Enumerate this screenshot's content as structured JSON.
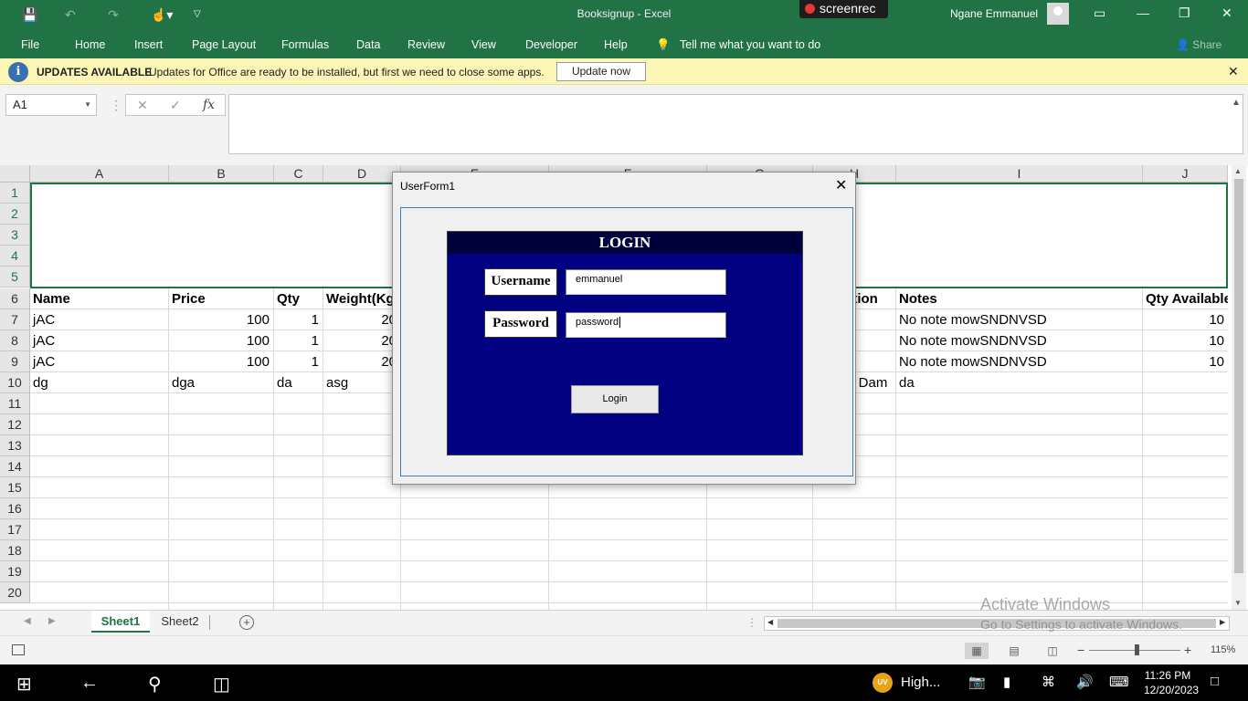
{
  "app": {
    "title": "Booksignup  -  Excel",
    "user_name": "Ngane Emmanuel",
    "screenrec_label": "screenrec",
    "brand_color": "#217346"
  },
  "ribbon": {
    "tabs": [
      "File",
      "Home",
      "Insert",
      "Page Layout",
      "Formulas",
      "Data",
      "Review",
      "View",
      "Developer",
      "Help"
    ],
    "tell_me": "Tell me what you want to do",
    "share": "Share"
  },
  "banner": {
    "title": "UPDATES AVAILABLE",
    "message": "Updates for Office are ready to be installed, but first we need to close some apps.",
    "button": "Update now"
  },
  "formula_bar": {
    "name_box": "A1",
    "fx_label": "fx",
    "value": ""
  },
  "columns": [
    "A",
    "B",
    "C",
    "D",
    "E",
    "F",
    "G",
    "H",
    "I",
    "J"
  ],
  "rows": [
    "1",
    "2",
    "3",
    "4",
    "5",
    "6",
    "7",
    "8",
    "9",
    "10",
    "11",
    "12",
    "13",
    "14",
    "15",
    "16",
    "17",
    "18",
    "19",
    "20"
  ],
  "cells": {
    "header": [
      "Name",
      "Price",
      "Qty",
      "Weight(Kg",
      "ction",
      "Notes",
      "Qty Available"
    ],
    "r7": [
      "jAC",
      "100",
      "1",
      "20",
      "No note mowSNDNVSD",
      "10"
    ],
    "r8": [
      "jAC",
      "100",
      "1",
      "20",
      "No note mowSNDNVSD",
      "10"
    ],
    "r9": [
      "jAC",
      "100",
      "1",
      "20",
      "No note mowSNDNVSD",
      "10"
    ],
    "r10": [
      "dg",
      "dga",
      "da",
      "asg",
      "y Dam",
      "da"
    ]
  },
  "sheets": {
    "tabs": [
      "Sheet1",
      "Sheet2"
    ],
    "active": "Sheet1"
  },
  "status": {
    "zoom": "115%",
    "zoom_minus": "−",
    "zoom_plus": "+"
  },
  "watermark": {
    "line1": "Activate Windows",
    "line2": "Go to Settings to activate Windows."
  },
  "dialog": {
    "title": "UserForm1",
    "heading": "LOGIN",
    "username_label": "Username",
    "username_value": "emmanuel",
    "password_label": "Password",
    "password_value": "password",
    "login_button": "Login"
  },
  "taskbar": {
    "weather_badge": "UV",
    "weather_text": "High...",
    "time": "11:26 PM",
    "date": "12/20/2023"
  }
}
